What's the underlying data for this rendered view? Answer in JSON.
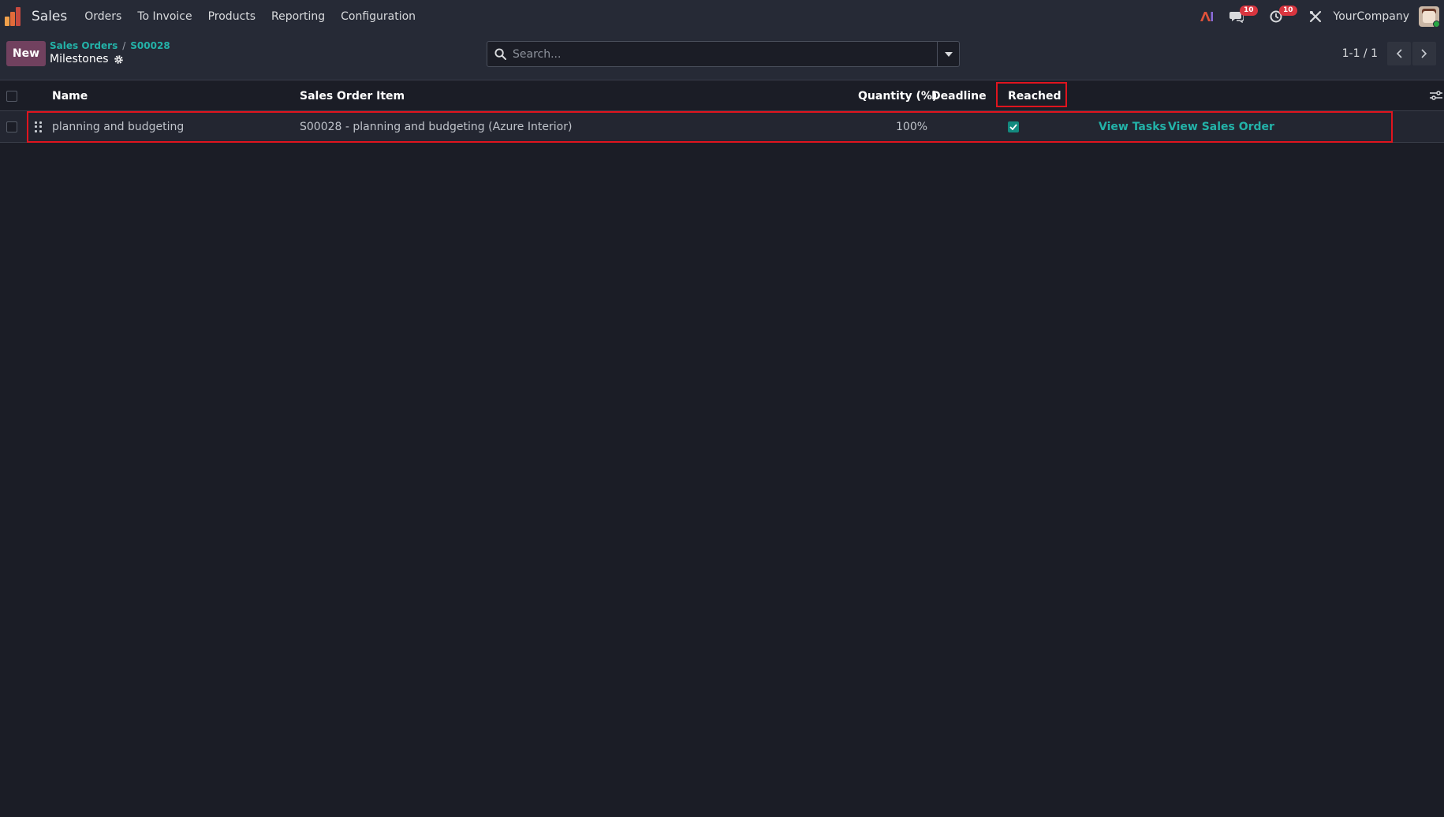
{
  "navbar": {
    "app_name": "Sales",
    "menu": [
      "Orders",
      "To Invoice",
      "Products",
      "Reporting",
      "Configuration"
    ],
    "chat_badge": "10",
    "activity_badge": "10",
    "company": "YourCompany"
  },
  "control_panel": {
    "new_label": "New",
    "breadcrumb": [
      "Sales Orders",
      "S00028"
    ],
    "title": "Milestones",
    "search_placeholder": "Search...",
    "pager": "1-1 / 1"
  },
  "table": {
    "headers": {
      "name": "Name",
      "sales_order_item": "Sales Order Item",
      "quantity": "Quantity (%)",
      "deadline": "Deadline",
      "reached": "Reached"
    },
    "rows": [
      {
        "name": "planning and budgeting",
        "sales_order_item": "S00028 - planning and budgeting (Azure Interior)",
        "quantity": "100%",
        "deadline": "",
        "reached": true,
        "view_tasks": "View Tasks",
        "view_sales_order": "View Sales Order"
      }
    ]
  },
  "colors": {
    "accent": "#23b2a8",
    "primary_button": "#71415f",
    "highlight": "#e0141e",
    "badge": "#d9353f"
  }
}
